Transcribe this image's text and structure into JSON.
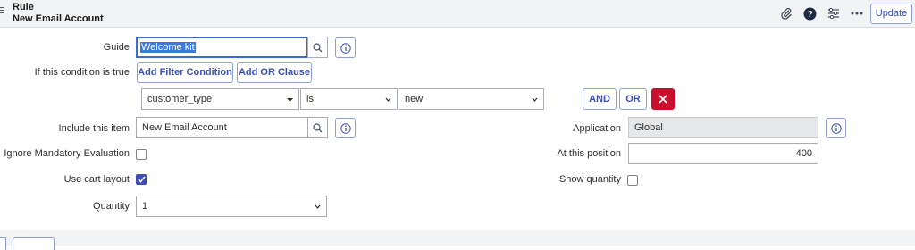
{
  "header": {
    "title": "Rule",
    "subtitle": "New Email Account",
    "update_label": "Update"
  },
  "form": {
    "guide": {
      "label": "Guide",
      "value": "Welcome kit"
    },
    "condition": {
      "label": "If this condition is true",
      "add_filter_label": "Add Filter Condition",
      "add_or_label": "Add OR Clause",
      "field": "customer_type",
      "operator": "is",
      "value": "new",
      "and_label": "AND",
      "or_label": "OR"
    },
    "include_item": {
      "label": "Include this item",
      "value": "New Email Account"
    },
    "ignore_mandatory": {
      "label": "Ignore Mandatory Evaluation",
      "checked": false
    },
    "use_cart_layout": {
      "label": "Use cart layout",
      "checked": true
    },
    "quantity": {
      "label": "Quantity",
      "value": "1"
    },
    "application": {
      "label": "Application",
      "value": "Global"
    },
    "position": {
      "label": "At this position",
      "value": "400"
    },
    "show_quantity": {
      "label": "Show quantity",
      "checked": false
    }
  },
  "icons": {
    "attachment": "paperclip-icon",
    "help": "help-icon",
    "settings": "sliders-icon",
    "more": "more-icon",
    "search": "search-icon",
    "info": "info-icon",
    "delete": "close-icon",
    "dropdown": "chevron-down-icon",
    "check": "check-icon"
  },
  "colors": {
    "accent": "#3c4fb0",
    "danger": "#c8102e",
    "header_bg": "#f2f3f5",
    "focus": "#3b6bd6"
  }
}
